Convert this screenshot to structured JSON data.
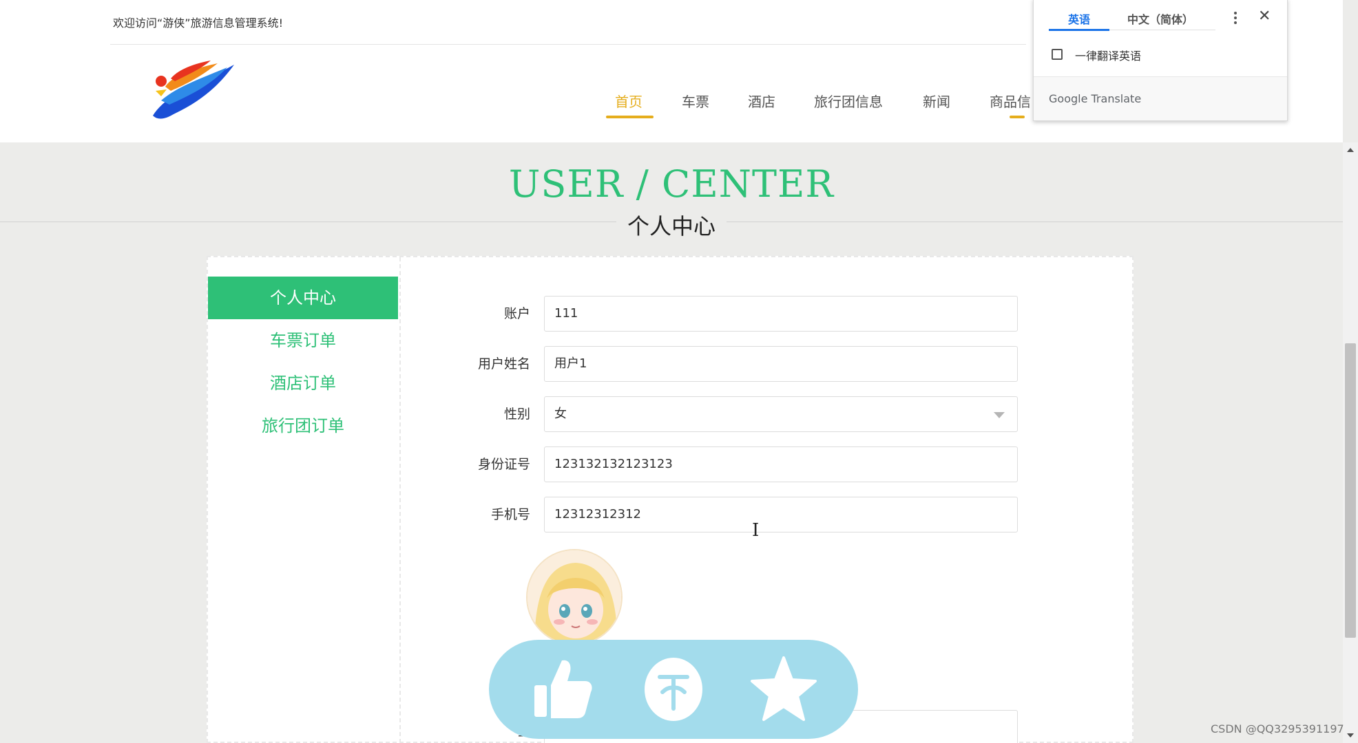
{
  "header": {
    "welcome": "欢迎访问“游侠”旅游信息管理系统!",
    "nav": [
      {
        "label": "首页",
        "active": true
      },
      {
        "label": "车票",
        "active": false
      },
      {
        "label": "酒店",
        "active": false
      },
      {
        "label": "旅行团信息",
        "active": false
      },
      {
        "label": "新闻",
        "active": false
      },
      {
        "label": "商品信",
        "active": false
      }
    ]
  },
  "title": {
    "en": "USER / CENTER",
    "cn": "个人中心"
  },
  "sidebar": {
    "items": [
      {
        "label": "个人中心",
        "active": true
      },
      {
        "label": "车票订单",
        "active": false
      },
      {
        "label": "酒店订单",
        "active": false
      },
      {
        "label": "旅行团订单",
        "active": false
      }
    ]
  },
  "form": {
    "account": {
      "label": "账户",
      "value": "111"
    },
    "name": {
      "label": "用户姓名",
      "value": "用户1"
    },
    "gender": {
      "label": "性别",
      "value": "女"
    },
    "id_number": {
      "label": "身份证号",
      "value": "123132132123123"
    },
    "phone": {
      "label": "手机号",
      "value": "12312312312"
    },
    "partial_label": "彐"
  },
  "action_bar": {
    "icons": [
      "thumbs-up-icon",
      "coin-icon",
      "star-icon"
    ],
    "color": "#a3dcec"
  },
  "translate_popup": {
    "tab_english": "英语",
    "tab_chinese": "中文（简体）",
    "always_translate": "一律翻译英语",
    "brand": "Google Translate",
    "close": "✕"
  },
  "watermark": "CSDN @QQ3295391197",
  "colors": {
    "accent_green": "#2ec077",
    "nav_active": "#e5ad1c",
    "gt_blue": "#1a73e8"
  }
}
